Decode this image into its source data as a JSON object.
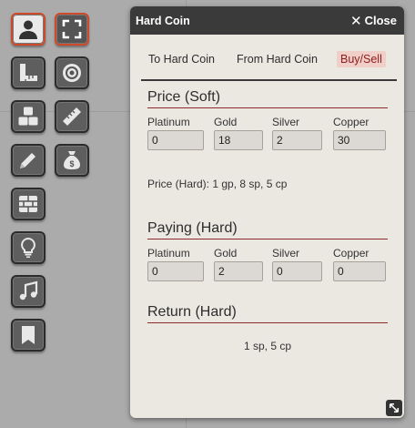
{
  "toolbar": {
    "tools": [
      {
        "name": "select-tool",
        "icon": "person-icon"
      },
      {
        "name": "fullscreen-tool",
        "icon": "expand-corners-icon"
      },
      {
        "name": "measure-tool",
        "icon": "ruler-square-icon"
      },
      {
        "name": "target-tool",
        "icon": "target-icon"
      },
      {
        "name": "cubes-tool",
        "icon": "cubes-icon"
      },
      {
        "name": "ruler-tool",
        "icon": "ruler-icon"
      },
      {
        "name": "draw-tool",
        "icon": "pencil-icon"
      },
      {
        "name": "money-tool",
        "icon": "money-bag-icon"
      },
      {
        "name": "wall-tool",
        "icon": "brick-wall-icon"
      },
      {
        "name": "hint-tool",
        "icon": "lightbulb-icon"
      },
      {
        "name": "music-tool",
        "icon": "music-note-icon"
      },
      {
        "name": "bookmark-tool",
        "icon": "bookmark-icon"
      }
    ],
    "accent": "#cf4a2a"
  },
  "dialog": {
    "title": "Hard Coin",
    "close_label": "Close",
    "tabs": [
      "To Hard Coin",
      "From Hard Coin",
      "Buy/Sell"
    ],
    "active_tab": "Buy/Sell",
    "price_soft": {
      "heading": "Price (Soft)",
      "fields": [
        {
          "label": "Platinum",
          "value": "0"
        },
        {
          "label": "Gold",
          "value": "18"
        },
        {
          "label": "Silver",
          "value": "2"
        },
        {
          "label": "Copper",
          "value": "30"
        }
      ],
      "hard_text": "Price (Hard): 1 gp, 8 sp, 5 cp"
    },
    "paying_hard": {
      "heading": "Paying (Hard)",
      "fields": [
        {
          "label": "Platinum",
          "value": "0"
        },
        {
          "label": "Gold",
          "value": "2"
        },
        {
          "label": "Silver",
          "value": "0"
        },
        {
          "label": "Copper",
          "value": "0"
        }
      ]
    },
    "return_hard": {
      "heading": "Return (Hard)",
      "value": "1 sp, 5 cp"
    }
  }
}
